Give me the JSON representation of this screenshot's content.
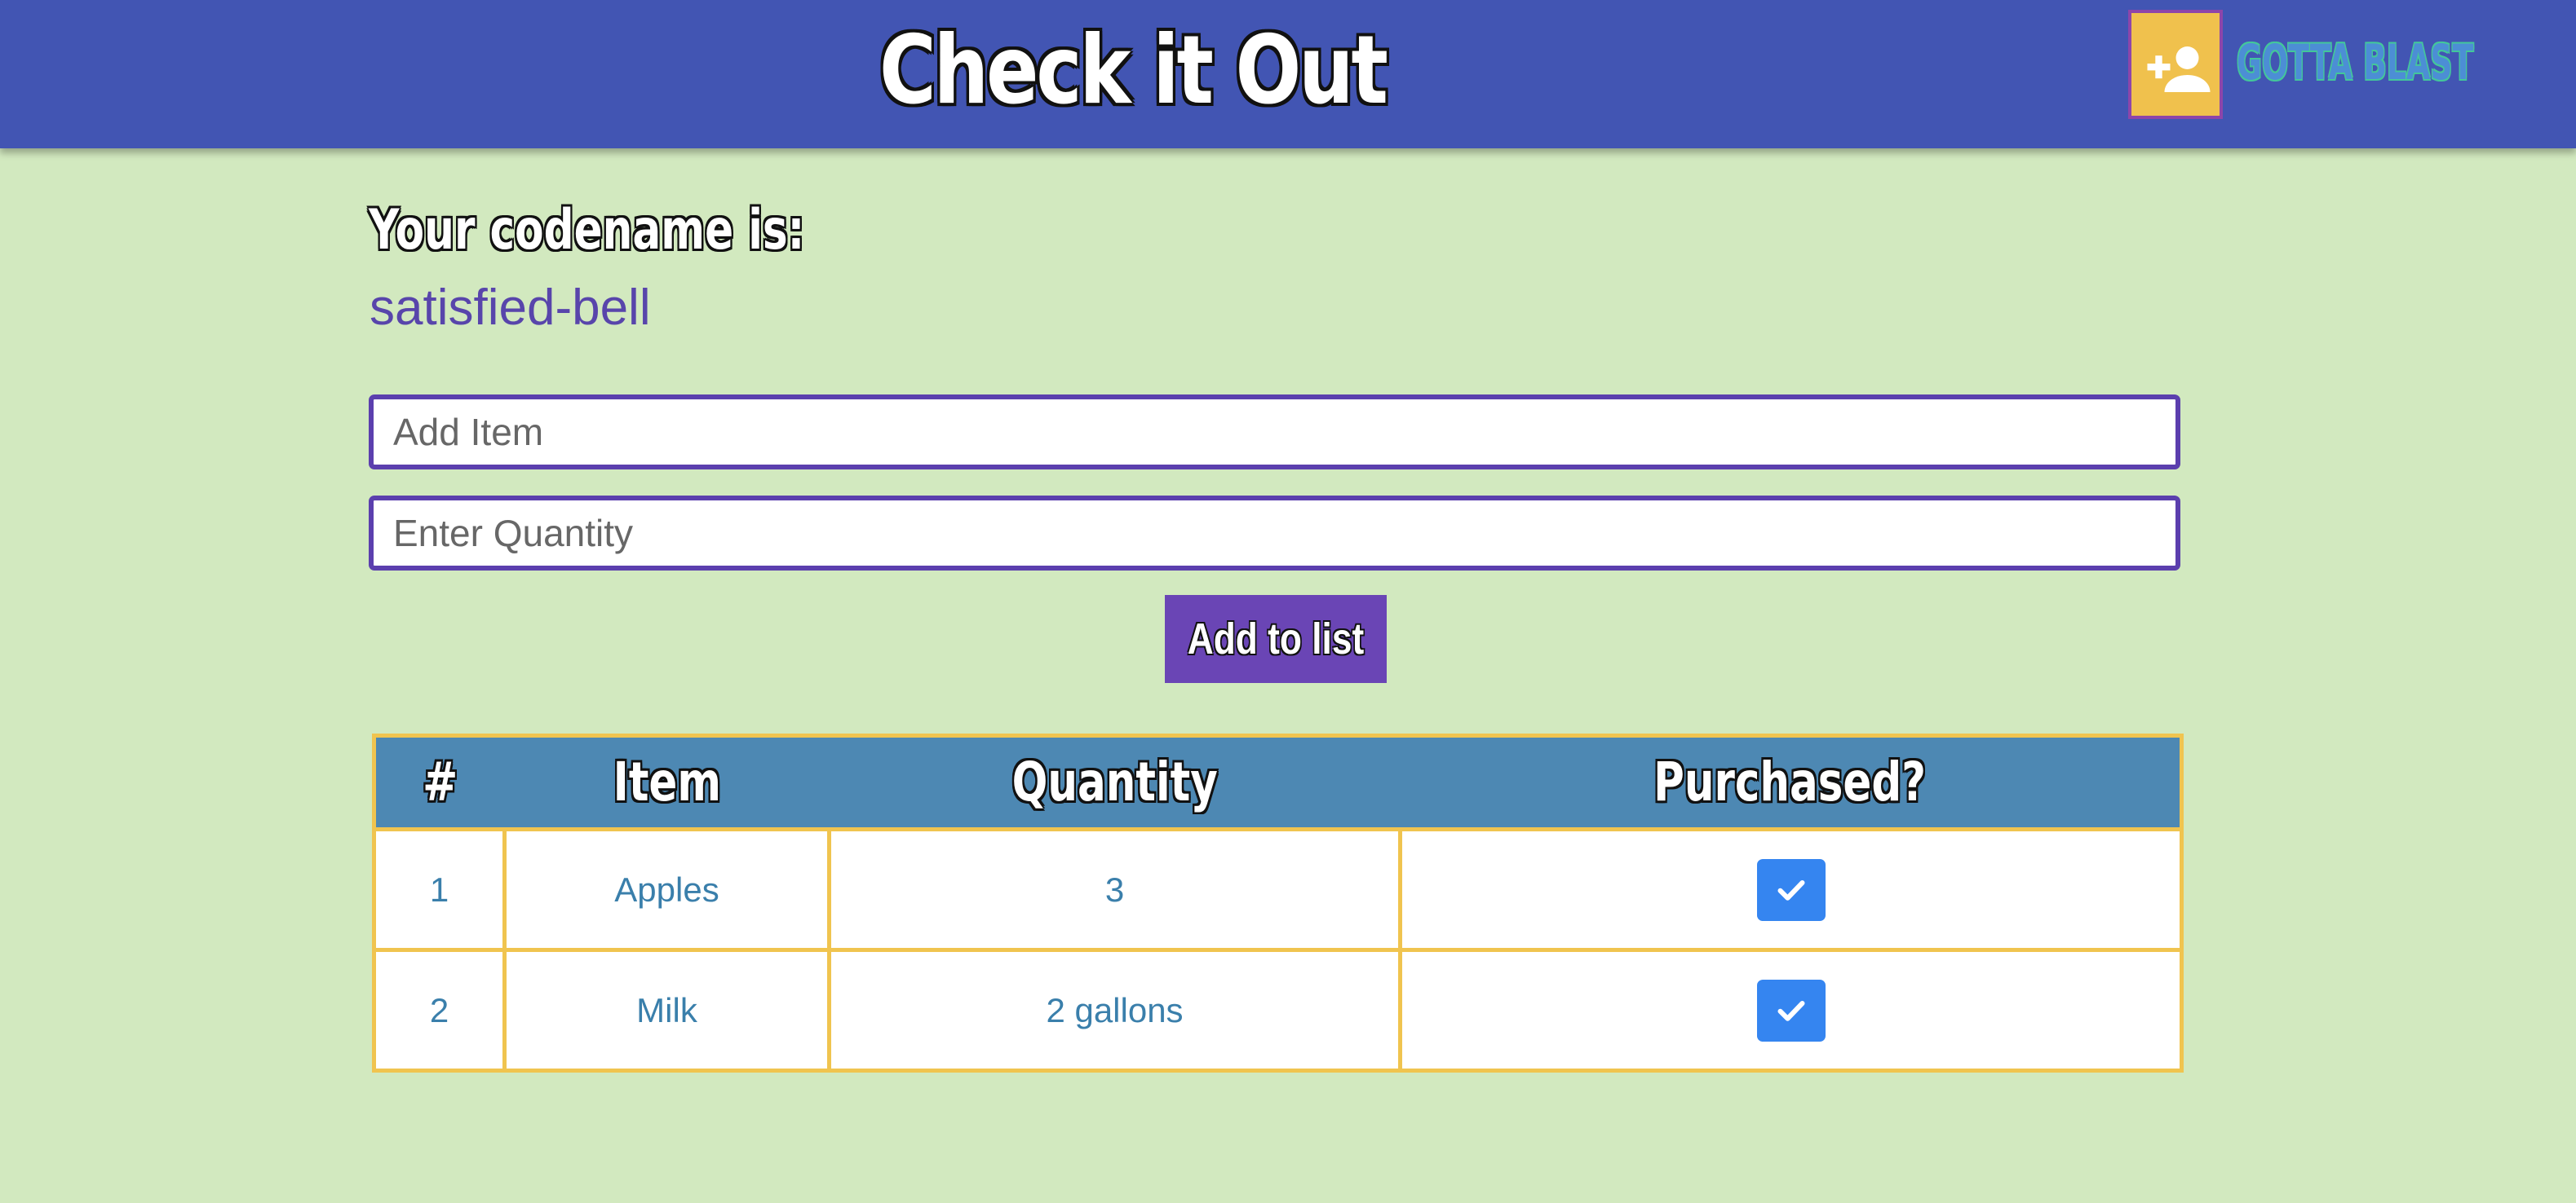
{
  "navbar": {
    "brand": "Check it Out",
    "brand_sub": "GOTTA BLAST",
    "user_icon": "add-user-icon"
  },
  "codename": {
    "label": "Your codename is:",
    "value": "satisfied-bell"
  },
  "form": {
    "item_placeholder": "Add Item",
    "item_value": "",
    "quantity_placeholder": "Enter Quantity",
    "quantity_value": "",
    "add_button_label": "Add to list"
  },
  "table": {
    "headers": [
      "#",
      "Item",
      "Quantity",
      "Purchased?"
    ],
    "rows": [
      {
        "num": "1",
        "item": "Apples",
        "quantity": "3",
        "purchased": true,
        "check_icon": "check-icon"
      },
      {
        "num": "2",
        "item": "Milk",
        "quantity": "2 gallons",
        "purchased": true,
        "check_icon": "check-icon"
      }
    ]
  },
  "colors": {
    "navbar": "#4255b3",
    "page_background": "#d2e9bf",
    "accent_purple": "#6a45b5",
    "table_header": "#4d88b3",
    "table_border": "#f0c44f",
    "user_button": "#f0c14d",
    "check_button": "#3585f0",
    "codename_text": "#5845ab"
  }
}
